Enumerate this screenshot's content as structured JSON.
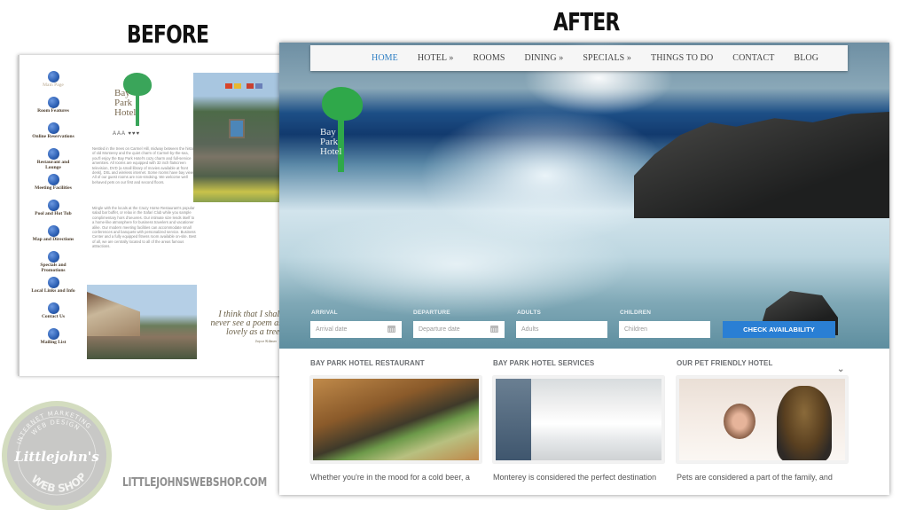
{
  "headings": {
    "before": "BEFORE",
    "after": "AFTER"
  },
  "before_site": {
    "logo_text": [
      "Bay",
      "Park",
      "Hotel"
    ],
    "ratings": "AAA ♥♥♥",
    "nav": [
      {
        "label": "Main Page",
        "active": true
      },
      {
        "label": "Room Features"
      },
      {
        "label": "Online Reservations"
      },
      {
        "label": "Restaurant and Lounge"
      },
      {
        "label": "Meeting Facilities"
      },
      {
        "label": "Pool and Hot Tub"
      },
      {
        "label": "Map and Directions"
      },
      {
        "label": "Specials and Promotions"
      },
      {
        "label": "Local Links and Info"
      },
      {
        "label": "Contact Us"
      },
      {
        "label": "Mailing List"
      }
    ],
    "paragraph1": "Nestled in the trees on Carmel Hill, midway between the history of old Monterey and the quiet charm of Carmel-by-the-sea, you'll enjoy the Bay Park Hotel's cozy charm and full-service amenities. All rooms are equipped with 32 inch flatscreen television, DVD (a small library of movies available at front desk), DSL and wireless internet. Some rooms have bay views. All of our guest rooms are non-smoking. We welcome well behaved pets on our first and second floors.",
    "paragraph2": "Mingle with the locals at the Crazy Horse Restaurant's popular salad bar buffet, or relax in the Safari Club while you sample complimentary hors d'oeuvres. Our intimate size lends itself to a home-like atmosphere for business travelers and vacationer alike. Our modern meeting facilities can accommodate small conferences and banquets with personalized service. Business Center and a fully equipped fitness room available on-site. Best of all, we are centrally located to all of the areas famous attractions.",
    "quote": "I think that I shall never see a poem as lovely as a tree.",
    "quote_author": "Joyce Kilmer"
  },
  "after_site": {
    "logo_text": [
      "Bay",
      "Park",
      "Hotel"
    ],
    "nav": [
      {
        "label": "HOME",
        "active": true
      },
      {
        "label": "HOTEL »"
      },
      {
        "label": "ROOMS"
      },
      {
        "label": "DINING »"
      },
      {
        "label": "SPECIALS »"
      },
      {
        "label": "THINGS TO DO"
      },
      {
        "label": "CONTACT"
      },
      {
        "label": "BLOG"
      }
    ],
    "booking": {
      "arrival_label": "ARRIVAL",
      "arrival_placeholder": "Arrival date",
      "departure_label": "DEPARTURE",
      "departure_placeholder": "Departure date",
      "adults_label": "ADULTS",
      "adults_placeholder": "Adults",
      "children_label": "CHILDREN",
      "children_placeholder": "Children",
      "submit_label": "CHECK AVAILABILITY"
    },
    "sections": [
      {
        "title": "BAY PARK HOTEL RESTAURANT",
        "text": "Whether you're in the mood for a cold beer, a"
      },
      {
        "title": "BAY PARK HOTEL  SERVICES",
        "text": "Monterey is considered the perfect destination"
      },
      {
        "title": "OUR PET FRIENDLY HOTEL",
        "text": "Pets are considered a part of the family, and"
      }
    ],
    "colors": {
      "accent": "#2a7fd4",
      "nav_active": "#2f7fc4",
      "logo_green": "#2fa84a"
    }
  },
  "branding": {
    "badge_lines": [
      "WEB DESIGN",
      "INTERNET MARKETING",
      "Littlejohn's",
      "WEB SHOP"
    ],
    "url": "LITTLEJOHNSWEBSHOP.COM"
  }
}
